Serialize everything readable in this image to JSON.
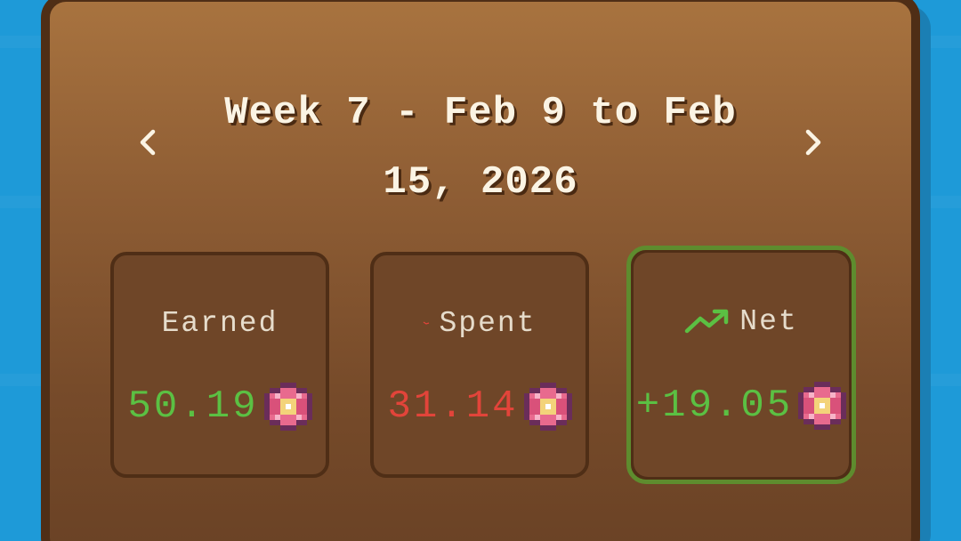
{
  "header": {
    "title": "Week 7 - Feb 9 to Feb 15, 2026",
    "prev_icon": "chevron-left-icon",
    "next_icon": "chevron-right-icon"
  },
  "summary": {
    "earned": {
      "label": "Earned",
      "value": "50.19",
      "icon": "flower-icon"
    },
    "spent": {
      "label": "Spent",
      "value": "31.14",
      "icon": "flower-icon"
    },
    "net": {
      "label": "Net",
      "value": "+19.05",
      "icon": "flower-icon",
      "label_icon": "trend-up-icon"
    }
  },
  "colors": {
    "background": "#1e9ad8",
    "panel_border": "#4f2e16",
    "positive": "#5bc043",
    "negative": "#e2443a",
    "net_border": "#5e8c2e",
    "title_text": "#fbf4e4",
    "label_text": "#e6dccb"
  }
}
